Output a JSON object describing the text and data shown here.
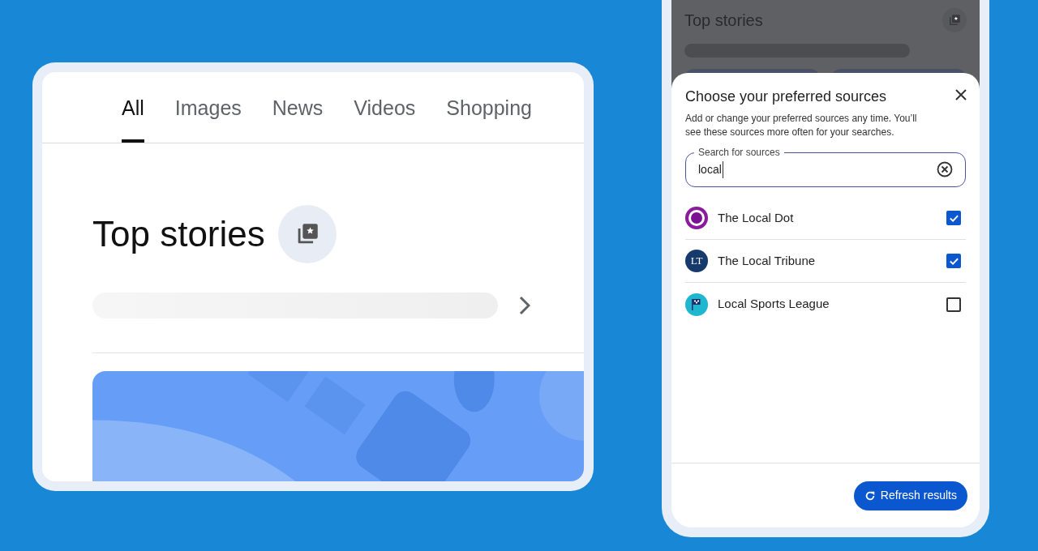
{
  "search_page": {
    "tabs": [
      {
        "label": "All",
        "selected": true
      },
      {
        "label": "Images",
        "selected": false
      },
      {
        "label": "News",
        "selected": false
      },
      {
        "label": "Videos",
        "selected": false
      },
      {
        "label": "Shopping",
        "selected": false
      }
    ],
    "heading": "Top stories"
  },
  "background_page": {
    "heading": "Top stories"
  },
  "dialog": {
    "title": "Choose your preferred sources",
    "description": "Add or change your preferred sources any time. You’ll see these sources more often for your searches.",
    "search": {
      "label": "Search for sources",
      "value": "local"
    },
    "sources": [
      {
        "name": "The Local Dot",
        "checked": true,
        "kind": "dot"
      },
      {
        "name": "The Local Tribune",
        "checked": true,
        "kind": "monogram",
        "monogram": "LT"
      },
      {
        "name": "Local Sports League",
        "checked": false,
        "kind": "flag"
      }
    ],
    "button": "Refresh results"
  }
}
